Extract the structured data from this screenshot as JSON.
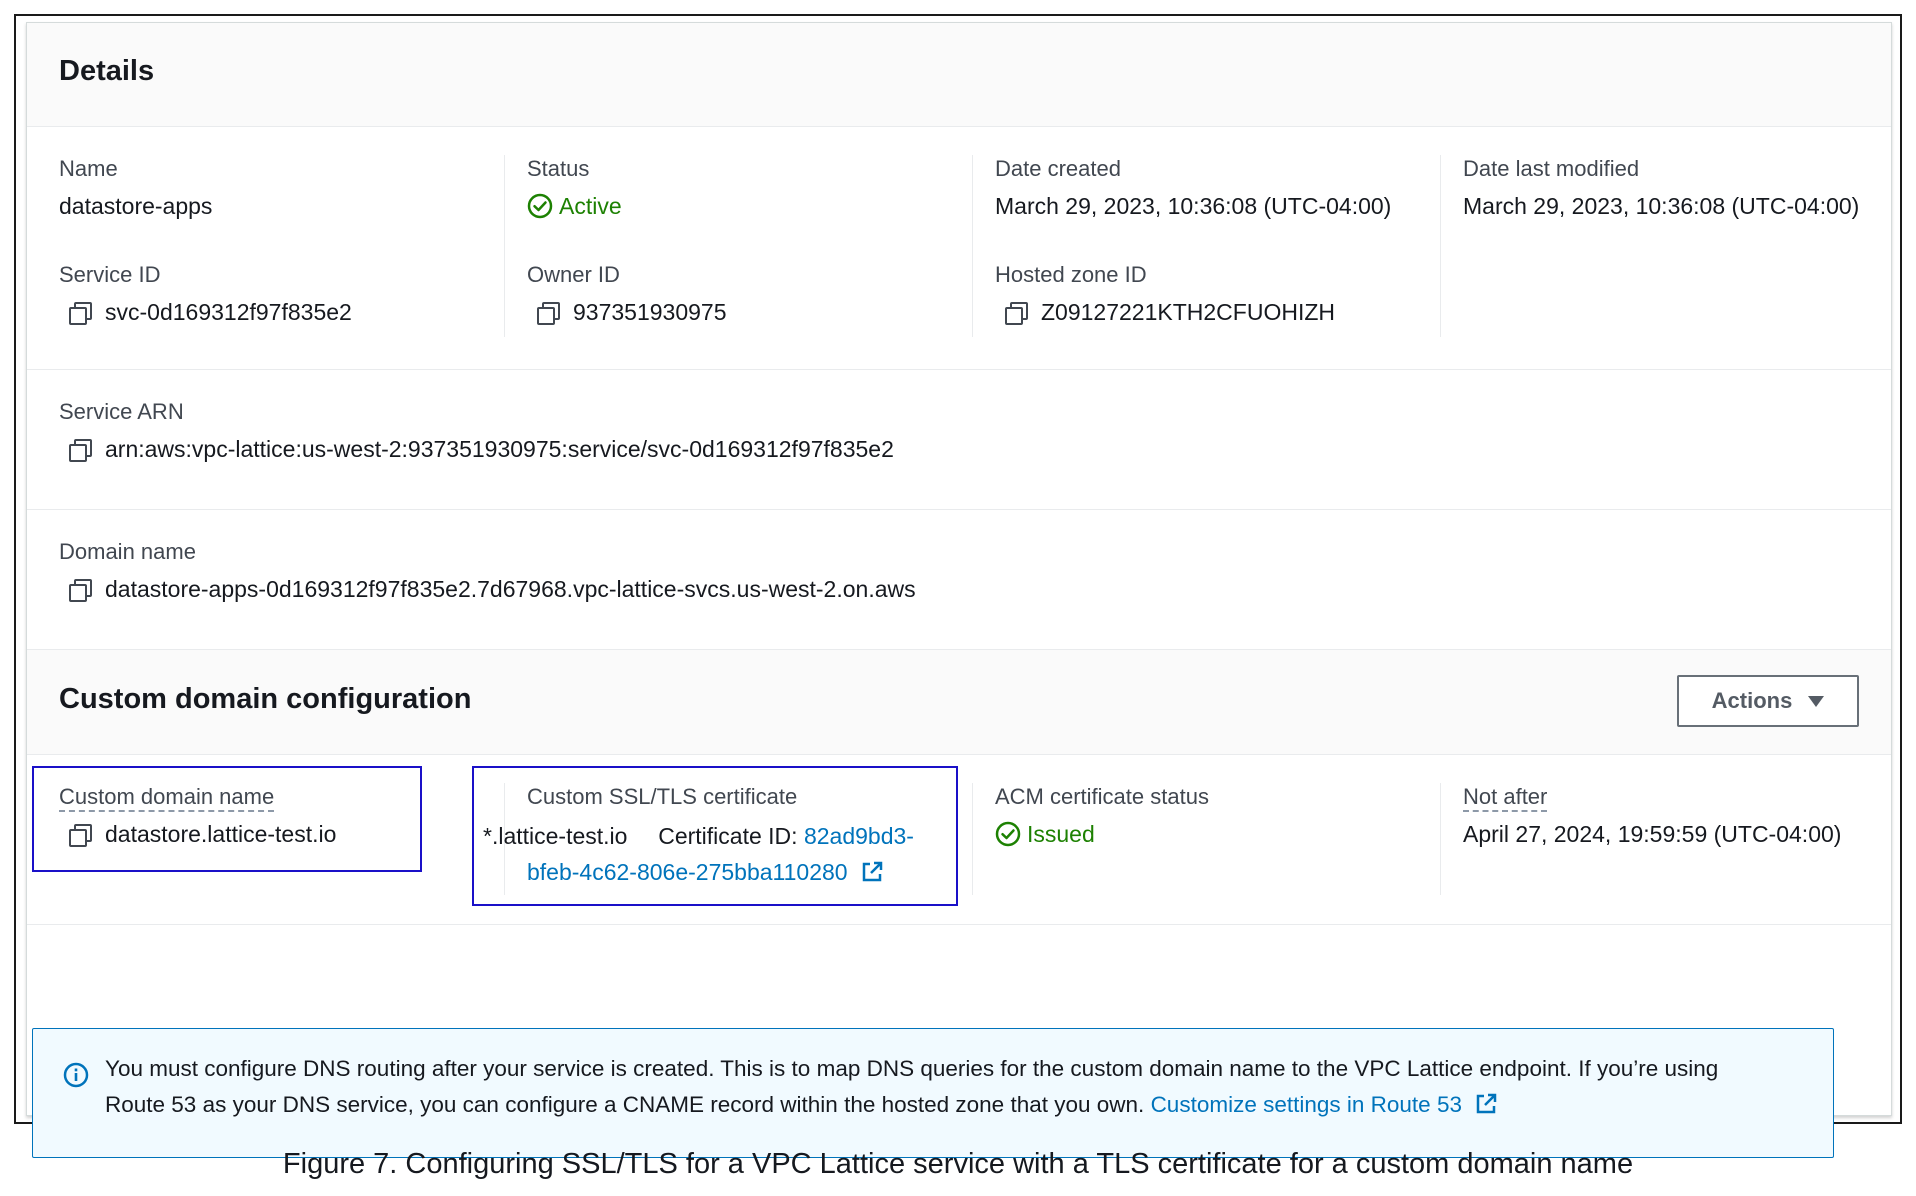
{
  "details": {
    "title": "Details",
    "name_label": "Name",
    "name_value": "datastore-apps",
    "status_label": "Status",
    "status_value": "Active",
    "date_created_label": "Date created",
    "date_created_value": "March 29, 2023, 10:36:08 (UTC-04:00)",
    "date_modified_label": "Date last modified",
    "date_modified_value": "March 29, 2023, 10:36:08 (UTC-04:00)",
    "service_id_label": "Service ID",
    "service_id_value": "svc-0d169312f97f835e2",
    "owner_id_label": "Owner ID",
    "owner_id_value": "937351930975",
    "hosted_zone_label": "Hosted zone ID",
    "hosted_zone_value": "Z09127221KTH2CFUOHIZH",
    "arn_label": "Service ARN",
    "arn_value": "arn:aws:vpc-lattice:us-west-2:937351930975:service/svc-0d169312f97f835e2",
    "domain_label": "Domain name",
    "domain_value": "datastore-apps-0d169312f97f835e2.7d67968.vpc-lattice-svcs.us-west-2.on.aws"
  },
  "custom_domain": {
    "title": "Custom domain configuration",
    "actions_label": "Actions",
    "name_label": "Custom domain name",
    "name_value": "datastore.lattice-test.io",
    "cert_label": "Custom SSL/TLS certificate",
    "cert_domain": "*.lattice-test.io",
    "cert_id_prefix": "Certificate ID:",
    "cert_id_part1": "82ad9bd3-",
    "cert_id_part2": "bfeb-4c62-806e-275bba110280",
    "acm_status_label": "ACM certificate status",
    "acm_status_value": "Issued",
    "not_after_label": "Not after",
    "not_after_value": "April 27, 2024, 19:59:59 (UTC-04:00)"
  },
  "alert": {
    "text_line1": "You must configure DNS routing after your service is created. This is to map DNS queries for the custom domain name to the VPC Lattice endpoint. If you’re using",
    "text_line2": "Route 53 as your DNS service, you can configure a CNAME record within the hosted zone that you own.",
    "link_text": "Customize settings in Route 53"
  },
  "caption": "Figure 7. Configuring SSL/TLS for a VPC Lattice service with a TLS certificate for a custom domain name",
  "colors": {
    "status_green": "#1d8102",
    "link_blue": "#0073bb",
    "highlight_border": "#1a10c8",
    "alert_bg": "#f1faff"
  }
}
